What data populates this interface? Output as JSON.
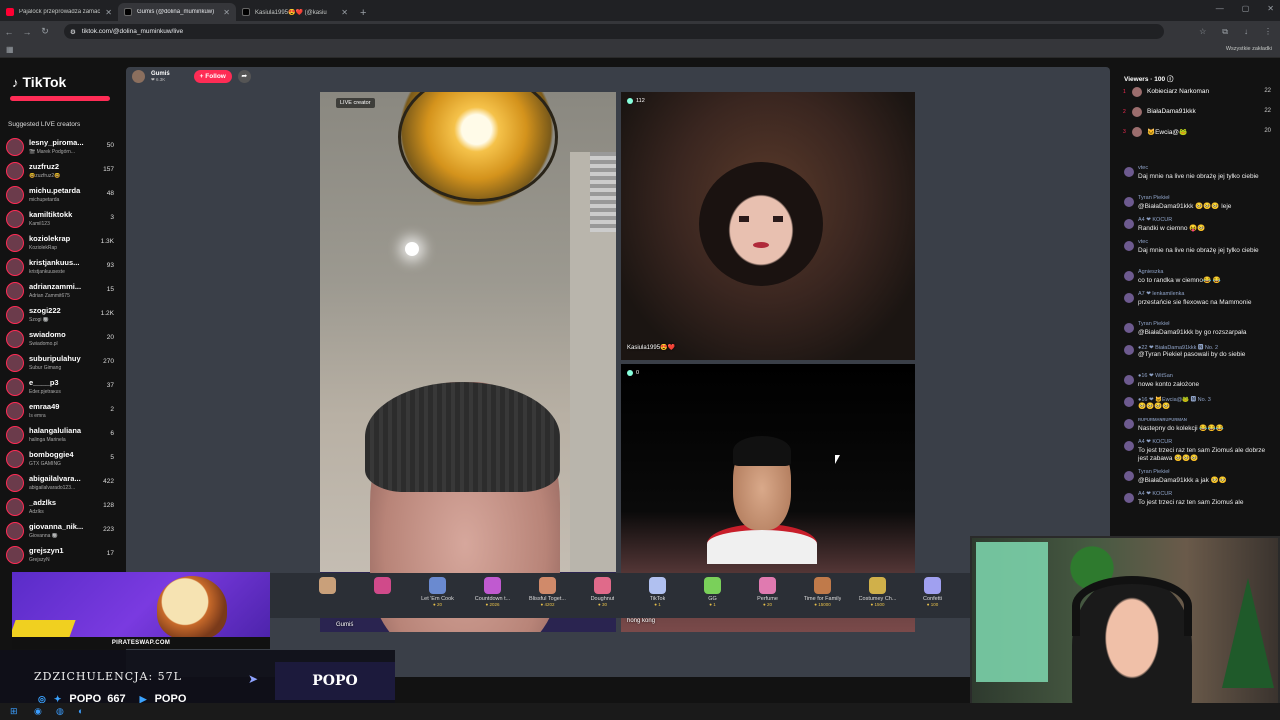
{
  "browser": {
    "tabs": [
      {
        "title": "Pajalock przeprowadza zamach",
        "color": "#ff0033",
        "active": false
      },
      {
        "title": "Gumiś (@dolina_muminkuw)",
        "color": "#ffffff",
        "active": true
      },
      {
        "title": "Kasiula1995😍❤️ (@kasiu",
        "color": "#ffffff",
        "active": false
      }
    ],
    "url": "tiktok.com/@dolina_muminkuw/live",
    "all_bookmarks": "Wszystkie zakładki"
  },
  "tiktok": {
    "logo": "TikTok",
    "suggested_title": "Suggested LIVE creators",
    "creators": [
      {
        "name": "lesny_piroma...",
        "sub": "🎬 Marek Podgórn...",
        "count": "50"
      },
      {
        "name": "zuzfruz2",
        "sub": "🤓zuzfruz2🤓",
        "count": "157"
      },
      {
        "name": "michu.petarda",
        "sub": "michupetarda",
        "count": "48"
      },
      {
        "name": "kamiltiktokk",
        "sub": "Kamil123",
        "count": "3"
      },
      {
        "name": "koziolekrap",
        "sub": "KoziolekRap",
        "count": "1.3K"
      },
      {
        "name": "kristjankuus...",
        "sub": "kristjankuuseste",
        "count": "93"
      },
      {
        "name": "adrianzammi...",
        "sub": "Adrian Zammit675",
        "count": "15"
      },
      {
        "name": "szogi222",
        "sub": "Szogi 🔘",
        "count": "1.2K"
      },
      {
        "name": "swiadomo",
        "sub": "Swiadomo.pl",
        "count": "20"
      },
      {
        "name": "suburipulahuy",
        "sub": "Subur Gimang",
        "count": "270"
      },
      {
        "name": "e____p3",
        "sub": "Eder.pjetraᴋᴜs",
        "count": "37"
      },
      {
        "name": "emraa49",
        "sub": "Is emra",
        "count": "2"
      },
      {
        "name": "halangaluliana",
        "sub": "halinga Marinela",
        "count": "6"
      },
      {
        "name": "bomboggie4",
        "sub": "GTX GAMING",
        "count": "5"
      },
      {
        "name": "abigailalvara...",
        "sub": "abigailalvarado123...",
        "count": "422"
      },
      {
        "name": "_adzlks",
        "sub": "Adzlks",
        "count": "128"
      },
      {
        "name": "giovanna_nik...",
        "sub": "Giovanna 🔘",
        "count": "223"
      },
      {
        "name": "grejszyn1",
        "sub": "GrejszyN",
        "count": "17"
      }
    ],
    "host": {
      "name": "Gumiś",
      "likes": "❤ 6.3K",
      "follow": "+ Follow"
    },
    "panels": {
      "main_tag": "LIVE creator",
      "main_name": "Gumiś",
      "tr_viewers": "112",
      "tr_name": "Kasiula1995😍❤️",
      "br_viewers": "0",
      "br_name": "hong kong"
    },
    "gifts": [
      {
        "name": "",
        "price": "",
        "color": "#c9a07a"
      },
      {
        "name": "",
        "price": "",
        "color": "#d04a8a"
      },
      {
        "name": "Let 'Em Cook",
        "price": "● 20",
        "color": "#6a8ad0"
      },
      {
        "name": "Countdown t...",
        "price": "● 2026",
        "color": "#c05ad0"
      },
      {
        "name": "Blissful Toget...",
        "price": "● 4202",
        "color": "#d08a6a"
      },
      {
        "name": "Doughnut",
        "price": "● 30",
        "color": "#e06a8a"
      },
      {
        "name": "TikTok",
        "price": "● 1",
        "color": "#b0c0f0"
      },
      {
        "name": "GG",
        "price": "● 1",
        "color": "#7ad05a"
      },
      {
        "name": "Perfume",
        "price": "● 20",
        "color": "#e07ab0"
      },
      {
        "name": "Time for Family",
        "price": "● 15000",
        "color": "#c07a4a"
      },
      {
        "name": "Costumey Ch...",
        "price": "● 1500",
        "color": "#d0b04a"
      },
      {
        "name": "Confetti",
        "price": "● 100",
        "color": "#a0a0f0"
      }
    ]
  },
  "chat": {
    "viewers_title": "Viewers · 100 ⓘ",
    "top_viewers": [
      {
        "rank": "1",
        "name": "Kobieciarz Narkoman",
        "score": "22"
      },
      {
        "rank": "2",
        "name": "BiałaDama91kkk",
        "score": "22"
      },
      {
        "rank": "3",
        "name": "🐱Ewcia@🐸",
        "score": "20"
      }
    ],
    "messages": [
      {
        "user": "vtec",
        "text": "Daj mnie na live nie obrażę jej tylko ciebie"
      },
      {
        "user": "Tyran Piekieł",
        "text": "@BiałaDama91kkk 🥺🥺🥺 leje"
      },
      {
        "user": "A4 ❤ KOCUR",
        "text": "Randki w ciemno 😝🥺"
      },
      {
        "user": "vtec",
        "text": "Daj mnie na live nie obrażę jej tylko ciebie"
      },
      {
        "user": "Agnieszka",
        "text": "co to randka w ciemno😂 😂"
      },
      {
        "user": "A7 ❤ lenkamilenka",
        "text": "przestańcie sie flexowac na Mammonie"
      },
      {
        "user": "Tyran Piekieł",
        "text": "@BiałaDama91kkk by go rozszarpała"
      },
      {
        "user": "●22 ❤ BiałaDama91kkk 🅽 No. 2",
        "text": "@Tyran Piekieł pasowali by do siebie"
      },
      {
        "user": "●16 ❤ WitSan",
        "text": "nowe konto założone"
      },
      {
        "user": "●16 ❤ 🐱Ewcia@🐸 🅽 No. 3",
        "text": "🥺🥺🥺🥺"
      },
      {
        "user": "ʀᴜᴘᴜʀᴍᴀɴʀᴜᴘᴜʀᴍᴀɴ",
        "text": "Nastepny do kolekcji 😂😂😂"
      },
      {
        "user": "A4 ❤ KOCUR",
        "text": "To jest trzeci raz ten sam Ziomuś ale dobrze jest zabawa 🥺🥺🥺"
      },
      {
        "user": "Tyran Piekieł",
        "text": "@BiałaDama91kkk a jak 🥺🥺"
      },
      {
        "user": "A4 ❤ KOCUR",
        "text": "To jest trzeci raz ten sam Ziomuś ale"
      }
    ]
  },
  "overlay": {
    "ad_caption": "PIRATESWAP.COM",
    "banner_text": "ZDZICHULENCJA: 57L",
    "popo_box": "POPO",
    "social_handle": "POPO_667",
    "youtube_handle": "POPO"
  }
}
